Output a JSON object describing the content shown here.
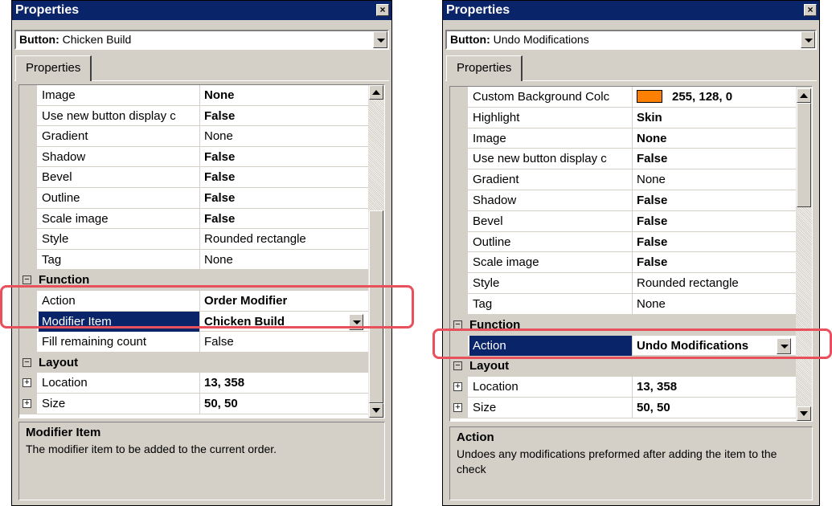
{
  "left": {
    "title": "Properties",
    "selector": {
      "kind": "Button:",
      "name": "Chicken Build"
    },
    "tab": "Properties",
    "rows": [
      {
        "type": "prop",
        "name": "Image",
        "value": "None",
        "bold": true
      },
      {
        "type": "prop",
        "name": "Use new button display c",
        "value": "False",
        "bold": true
      },
      {
        "type": "prop",
        "name": "Gradient",
        "value": "None",
        "bold": false
      },
      {
        "type": "prop",
        "name": "Shadow",
        "value": "False",
        "bold": true
      },
      {
        "type": "prop",
        "name": "Bevel",
        "value": "False",
        "bold": true
      },
      {
        "type": "prop",
        "name": "Outline",
        "value": "False",
        "bold": true
      },
      {
        "type": "prop",
        "name": "Scale image",
        "value": "False",
        "bold": true
      },
      {
        "type": "prop",
        "name": "Style",
        "value": "Rounded rectangle",
        "bold": false
      },
      {
        "type": "prop",
        "name": "Tag",
        "value": "None",
        "bold": false
      },
      {
        "type": "category",
        "name": "Function",
        "expander": "⊟"
      },
      {
        "type": "prop",
        "name": "Action",
        "value": "Order Modifier",
        "bold": true
      },
      {
        "type": "prop",
        "name": "Modifier Item",
        "value": "Chicken Build",
        "bold": true,
        "selected": true
      },
      {
        "type": "prop",
        "name": "Fill remaining count",
        "value": "False",
        "bold": false
      },
      {
        "type": "category",
        "name": "Layout",
        "expander": "⊟"
      },
      {
        "type": "prop",
        "name": "Location",
        "value": "13, 358",
        "bold": true,
        "expander": "+"
      },
      {
        "type": "prop",
        "name": "Size",
        "value": "50, 50",
        "bold": true,
        "expander": "+"
      }
    ],
    "description": {
      "title": "Modifier Item",
      "text": "The modifier item to be added to the current order."
    }
  },
  "right": {
    "title": "Properties",
    "selector": {
      "kind": "Button:",
      "name": "Undo Modifications"
    },
    "tab": "Properties",
    "rows": [
      {
        "type": "prop",
        "name": "Custom Background Colc",
        "value": "255, 128, 0",
        "bold": true,
        "swatch": "#ff8000"
      },
      {
        "type": "prop",
        "name": "Highlight",
        "value": "Skin",
        "bold": true
      },
      {
        "type": "prop",
        "name": "Image",
        "value": "None",
        "bold": true
      },
      {
        "type": "prop",
        "name": "Use new button display c",
        "value": "False",
        "bold": true
      },
      {
        "type": "prop",
        "name": "Gradient",
        "value": "None",
        "bold": false
      },
      {
        "type": "prop",
        "name": "Shadow",
        "value": "False",
        "bold": true
      },
      {
        "type": "prop",
        "name": "Bevel",
        "value": "False",
        "bold": true
      },
      {
        "type": "prop",
        "name": "Outline",
        "value": "False",
        "bold": true
      },
      {
        "type": "prop",
        "name": "Scale image",
        "value": "False",
        "bold": true
      },
      {
        "type": "prop",
        "name": "Style",
        "value": "Rounded rectangle",
        "bold": false
      },
      {
        "type": "prop",
        "name": "Tag",
        "value": "None",
        "bold": false
      },
      {
        "type": "category",
        "name": "Function",
        "expander": "⊟"
      },
      {
        "type": "prop",
        "name": "Action",
        "value": "Undo Modifications",
        "bold": true,
        "selected": true
      },
      {
        "type": "category",
        "name": "Layout",
        "expander": "⊟"
      },
      {
        "type": "prop",
        "name": "Location",
        "value": "13, 358",
        "bold": true,
        "expander": "+"
      },
      {
        "type": "prop",
        "name": "Size",
        "value": "50, 50",
        "bold": true,
        "expander": "+"
      }
    ],
    "description": {
      "title": "Action",
      "text": "Undoes any modifications preformed after adding the item to the check"
    }
  },
  "colors": {
    "highlight_box": "#e8505b",
    "selection": "#0a246a",
    "custom_bg_swatch": "#ff8000"
  }
}
